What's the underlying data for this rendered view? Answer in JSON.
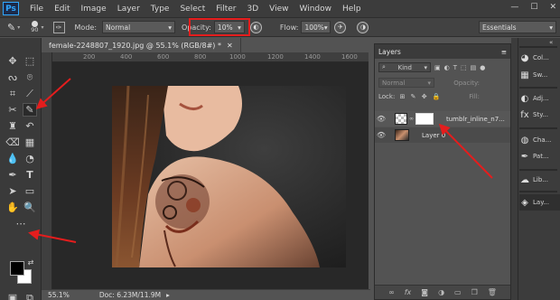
{
  "app": {
    "logo": "Ps"
  },
  "menu": [
    "File",
    "Edit",
    "Image",
    "Layer",
    "Type",
    "Select",
    "Filter",
    "3D",
    "View",
    "Window",
    "Help"
  ],
  "window_controls": [
    "—",
    "☐",
    "✕"
  ],
  "options": {
    "brush_size": "90",
    "mode_label": "Mode:",
    "mode_value": "Normal",
    "opacity_label": "Opacity:",
    "opacity_value": "10%",
    "flow_label": "Flow:",
    "flow_value": "100%",
    "workspace": "Essentials"
  },
  "document": {
    "tab_title": "female-2248807_1920.jpg @ 55.1% (RGB/8#) *",
    "ruler_ticks": [
      "200",
      "400",
      "600",
      "800",
      "1000",
      "1200",
      "1400",
      "1600"
    ],
    "zoom": "55.1%",
    "doc_size": "Doc: 6.23M/11.9M"
  },
  "layers_panel": {
    "title": "Layers",
    "filter_kind": "Kind",
    "blend_mode": "Normal",
    "opacity_label": "Opacity:",
    "lock_label": "Lock:",
    "fill_label": "Fill:",
    "layers": [
      {
        "name": "tumblr_inline_n7...",
        "visible": true
      },
      {
        "name": "Layer 0",
        "visible": true
      }
    ]
  },
  "right_panels": [
    {
      "label": "Col...",
      "icon": "color-wheel-icon"
    },
    {
      "label": "Sw...",
      "icon": "swatches-icon"
    },
    {
      "label": "Adj...",
      "icon": "adjustments-icon"
    },
    {
      "label": "Sty...",
      "icon": "styles-icon"
    },
    {
      "label": "Cha...",
      "icon": "channels-icon"
    },
    {
      "label": "Pat...",
      "icon": "paths-icon"
    },
    {
      "label": "Lib...",
      "icon": "libraries-icon"
    },
    {
      "label": "Lay...",
      "icon": "layers-icon"
    }
  ],
  "colors": {
    "highlight": "#e41d1d",
    "foreground": "#000000",
    "background": "#ffffff"
  }
}
